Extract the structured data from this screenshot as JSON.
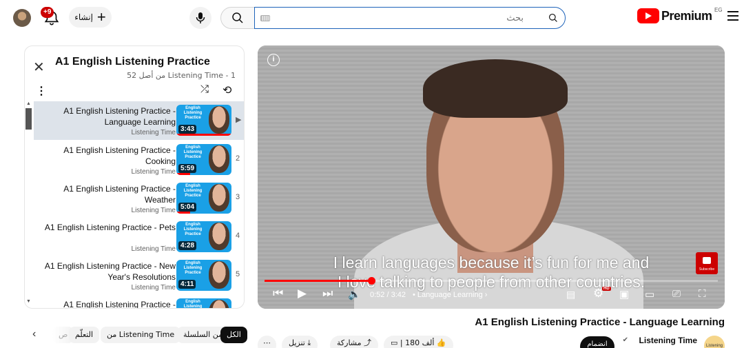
{
  "header": {
    "notifications_badge": "+9",
    "create_label": "إنشاء",
    "search_placeholder": "بحث",
    "search_value": "",
    "logo_text": "Premium",
    "region": "EG"
  },
  "playlist": {
    "title": "A1 English Listening Practice",
    "subtitle": "Listening Time - 1 من أصل 52",
    "items": [
      {
        "title": "A1 English Listening Practice - Language Learning",
        "channel": "Listening Time",
        "duration": "3:43",
        "index": "▶",
        "thumb_text": "English Listening Practice",
        "progress": 1.0,
        "active": true
      },
      {
        "title": "A1 English Listening Practice - Cooking",
        "channel": "Listening Time",
        "duration": "5:59",
        "index": "2",
        "thumb_text": "English Listening Practice",
        "progress": 0.25
      },
      {
        "title": "A1 English Listening Practice - Weather",
        "channel": "Listening Time",
        "duration": "5:04",
        "index": "3",
        "thumb_text": "English Listening Practice",
        "progress": 0.25
      },
      {
        "title": "A1 English Listening Practice - Pets",
        "channel": "Listening Time",
        "duration": "4:28",
        "index": "4",
        "thumb_text": "English Listening Practice",
        "progress": 0
      },
      {
        "title": "A1 English Listening Practice - New Year's Resolutions",
        "channel": "Listening Time",
        "duration": "4:11",
        "index": "5",
        "thumb_text": "English Listening Practice",
        "progress": 0
      },
      {
        "title": "A1 English Listening Practice -",
        "channel": "",
        "duration": "",
        "index": "",
        "thumb_text": "English Listening",
        "progress": 0
      }
    ]
  },
  "chips": {
    "all": "الكل",
    "from_series": "من السلسلة",
    "from_channel": "من Listening Time",
    "learning": "التعلّم",
    "more": "ص"
  },
  "player": {
    "subtitle_line1": "I learn languages because it’s fun for me and",
    "subtitle_line2": "I love talking to people from other countries.",
    "time": "0:52 / 3:42",
    "chapter": "• Language Learning ›",
    "subscribe_badge": "Subscribe",
    "hd": "HD",
    "progress_fraction": 0.235
  },
  "video": {
    "title": "A1 English Listening Practice - Language Learning",
    "channel": "Listening Time",
    "channel_avatar_text": "Listening",
    "join_label": "انضمام",
    "likes": "180 ألف",
    "share": "مشاركة",
    "download": "تنزيل"
  }
}
